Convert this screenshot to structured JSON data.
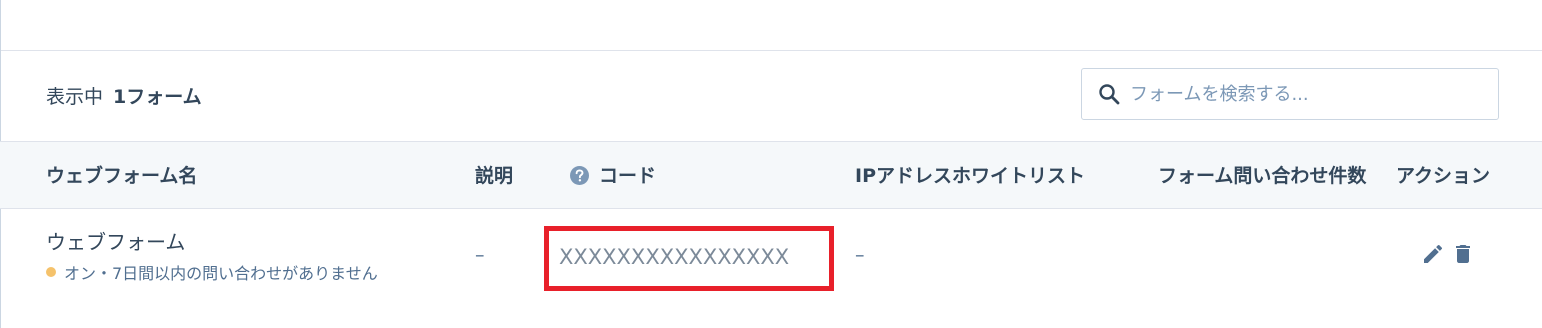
{
  "summary": {
    "label": "表示中",
    "count": "1フォーム"
  },
  "search": {
    "placeholder": "フォームを検索する..."
  },
  "table": {
    "headers": {
      "name": "ウェブフォーム名",
      "description": "説明",
      "code": "コード",
      "ip_whitelist": "IPアドレスホワイトリスト",
      "submissions": "フォーム問い合わせ件数",
      "actions": "アクション"
    },
    "rows": [
      {
        "name": "ウェブフォーム",
        "status": "オン・7日間以内の問い合わせがありません",
        "description": "–",
        "code": "XXXXXXXXXXXXXXXX",
        "ip_whitelist": "–"
      }
    ]
  },
  "colors": {
    "status_dot": "#f5c26b",
    "highlight": "#e8202a",
    "header_bg": "#f5f8fa"
  }
}
